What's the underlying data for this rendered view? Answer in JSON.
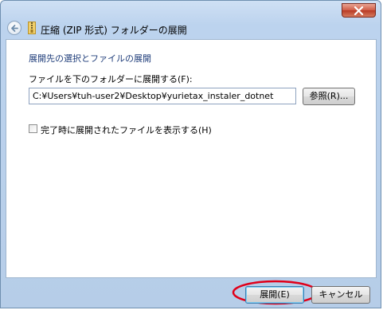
{
  "window": {
    "title": "圧縮 (ZIP 形式) フォルダーの展開"
  },
  "content": {
    "heading": "展開先の選択とファイルの展開",
    "destination_label": "ファイルを下のフォルダーに展開する(F):",
    "destination_path": "C:¥Users¥tuh-user2¥Desktop¥yurietax_instaler_dotnet",
    "browse_label": "参照(R)...",
    "show_files_label": "完了時に展開されたファイルを表示する(H)",
    "show_files_checked": false
  },
  "footer": {
    "extract_label": "展開(E)",
    "cancel_label": "キャンセル"
  },
  "colors": {
    "highlight": "#e0001a",
    "heading_text": "#1f3d7a"
  },
  "icons": {
    "back": "back-arrow-icon",
    "zip_folder": "zip-folder-icon",
    "close": "close-icon"
  }
}
